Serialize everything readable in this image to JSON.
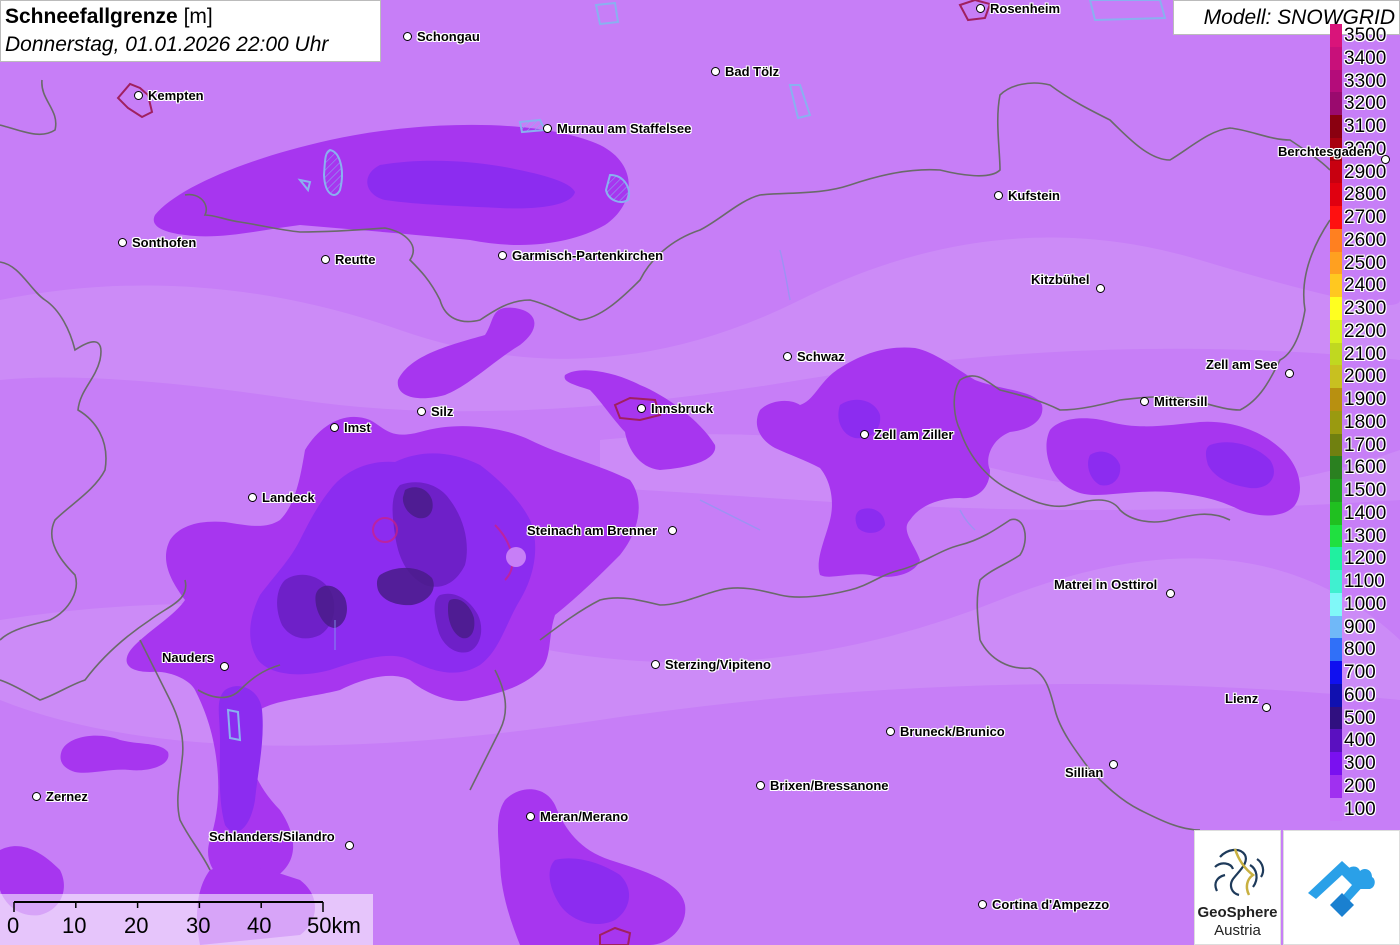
{
  "title": {
    "variable": "Schneefallgrenze",
    "unit": "[m]",
    "datetime": "Donnerstag, 01.01.2026 22:00 Uhr"
  },
  "model": "Modell: SNOWGRID",
  "legend": [
    {
      "label": "3500",
      "color": "#d9147a"
    },
    {
      "label": "3400",
      "color": "#c8107a"
    },
    {
      "label": "3300",
      "color": "#b40c7a"
    },
    {
      "label": "3200",
      "color": "#9a0a6e"
    },
    {
      "label": "3100",
      "color": "#8a0010"
    },
    {
      "label": "3000",
      "color": "#a80010"
    },
    {
      "label": "2900",
      "color": "#c80010"
    },
    {
      "label": "2800",
      "color": "#e00010"
    },
    {
      "label": "2700",
      "color": "#ff1010"
    },
    {
      "label": "2600",
      "color": "#ff8020"
    },
    {
      "label": "2500",
      "color": "#ffa020"
    },
    {
      "label": "2400",
      "color": "#ffc820"
    },
    {
      "label": "2300",
      "color": "#ffff20"
    },
    {
      "label": "2200",
      "color": "#d8f020"
    },
    {
      "label": "2100",
      "color": "#c0d820"
    },
    {
      "label": "2000",
      "color": "#c8c020"
    },
    {
      "label": "1900",
      "color": "#b89010"
    },
    {
      "label": "1800",
      "color": "#9a9a10"
    },
    {
      "label": "1700",
      "color": "#708010"
    },
    {
      "label": "1600",
      "color": "#2a8020"
    },
    {
      "label": "1500",
      "color": "#20a020"
    },
    {
      "label": "1400",
      "color": "#20c020"
    },
    {
      "label": "1300",
      "color": "#20e040"
    },
    {
      "label": "1200",
      "color": "#20f0a0"
    },
    {
      "label": "1100",
      "color": "#40f0d0"
    },
    {
      "label": "1000",
      "color": "#80f8f8"
    },
    {
      "label": "900",
      "color": "#70b8f8"
    },
    {
      "label": "800",
      "color": "#3070f8"
    },
    {
      "label": "700",
      "color": "#1010f0"
    },
    {
      "label": "600",
      "color": "#1010b0"
    },
    {
      "label": "500",
      "color": "#301080"
    },
    {
      "label": "400",
      "color": "#5a10c0"
    },
    {
      "label": "300",
      "color": "#7a10f0"
    },
    {
      "label": "200",
      "color": "#a030f0"
    },
    {
      "label": "100",
      "color": "#c878f8"
    }
  ],
  "cities": [
    {
      "name": "Rosenheim",
      "labelSide": "right"
    },
    {
      "name": "Schongau",
      "labelSide": "right"
    },
    {
      "name": "Bad Tölz",
      "labelSide": "right"
    },
    {
      "name": "Kempten",
      "labelSide": "right"
    },
    {
      "name": "Murnau am Staffelsee",
      "labelSide": "right"
    },
    {
      "name": "Berchtesgaden",
      "labelSide": "left"
    },
    {
      "name": "Kufstein",
      "labelSide": "right"
    },
    {
      "name": "Sonthofen",
      "labelSide": "right"
    },
    {
      "name": "Reutte",
      "labelSide": "right"
    },
    {
      "name": "Garmisch-Partenkirchen",
      "labelSide": "right"
    },
    {
      "name": "Kitzbühel",
      "labelSide": "left"
    },
    {
      "name": "Schwaz",
      "labelSide": "right"
    },
    {
      "name": "Zell am See",
      "labelSide": "left"
    },
    {
      "name": "Mittersill",
      "labelSide": "right"
    },
    {
      "name": "Innsbruck",
      "labelSide": "right"
    },
    {
      "name": "Silz",
      "labelSide": "right"
    },
    {
      "name": "Imst",
      "labelSide": "right"
    },
    {
      "name": "Zell am Ziller",
      "labelSide": "right"
    },
    {
      "name": "Landeck",
      "labelSide": "right"
    },
    {
      "name": "Steinach am Brenner",
      "labelSide": "left"
    },
    {
      "name": "Matrei in Osttirol",
      "labelSide": "left"
    },
    {
      "name": "Nauders",
      "labelSide": "left"
    },
    {
      "name": "Sterzing/Vipiteno",
      "labelSide": "right"
    },
    {
      "name": "Lienz",
      "labelSide": "left"
    },
    {
      "name": "Bruneck/Brunico",
      "labelSide": "right"
    },
    {
      "name": "Sillian",
      "labelSide": "left"
    },
    {
      "name": "Brixen/Bressanone",
      "labelSide": "right"
    },
    {
      "name": "Zernez",
      "labelSide": "right"
    },
    {
      "name": "Meran/Merano",
      "labelSide": "right"
    },
    {
      "name": "Schlanders/Silandro",
      "labelSide": "left"
    },
    {
      "name": "Cortina d'Ampezzo",
      "labelSide": "right"
    }
  ],
  "scale": {
    "ticks": [
      "0",
      "10",
      "20",
      "30",
      "40",
      "50km"
    ]
  },
  "logos": {
    "geosphere_name": "GeoSphere",
    "geosphere_sub": "Austria",
    "geosphere_icon": "geosphere-logo-icon",
    "cloud_icon": "cloud-mountain-logo-icon"
  },
  "colors": {
    "background": "#c77ef7",
    "zone200": "#a736ef",
    "zone300": "#8c2cf0",
    "zone400": "#6e20c8",
    "zone500": "#4a1c8a"
  }
}
